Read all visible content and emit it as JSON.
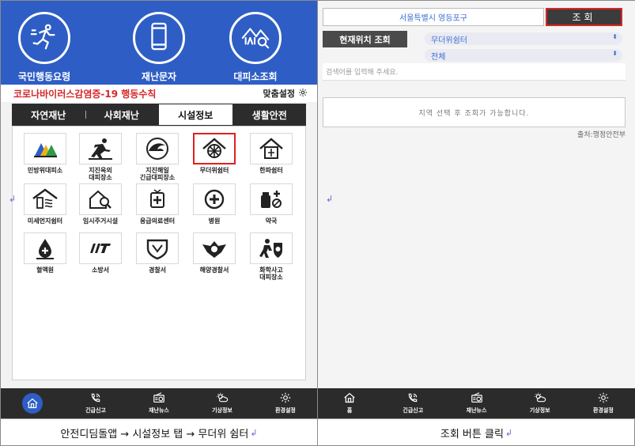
{
  "left": {
    "hero": {
      "items": [
        {
          "label": "국민행동요령",
          "icon": "running-person-icon"
        },
        {
          "label": "재난문자",
          "icon": "smartphone-icon"
        },
        {
          "label": "대피소조회",
          "icon": "shelter-search-icon"
        }
      ]
    },
    "covid_notice": "코로나바이러스감염증-19 행동수칙",
    "custom_settings": "맞춤설정",
    "tabs": [
      "자연재난",
      "사회재난",
      "시설정보",
      "생활안전"
    ],
    "active_tab": "시설정보",
    "facilities": [
      {
        "label": "민방위대피소",
        "icon": "civil-defense-shelter-icon"
      },
      {
        "label": "지진옥외\n대피장소",
        "icon": "earthquake-outdoor-icon"
      },
      {
        "label": "지진해일\n긴급대피장소",
        "icon": "tsunami-icon"
      },
      {
        "label": "무더위쉼터",
        "icon": "heat-shelter-icon",
        "selected": true
      },
      {
        "label": "한파쉼터",
        "icon": "cold-shelter-icon"
      },
      {
        "label": "미세먼지쉼터",
        "icon": "fine-dust-shelter-icon"
      },
      {
        "label": "임시주거시설",
        "icon": "temporary-housing-icon"
      },
      {
        "label": "응급의료센터",
        "icon": "emergency-medical-icon"
      },
      {
        "label": "병원",
        "icon": "hospital-icon"
      },
      {
        "label": "약국",
        "icon": "pharmacy-icon"
      },
      {
        "label": "혈액원",
        "icon": "blood-center-icon"
      },
      {
        "label": "소방서",
        "icon": "fire-station-icon"
      },
      {
        "label": "경찰서",
        "icon": "police-station-icon"
      },
      {
        "label": "해양경찰서",
        "icon": "coast-guard-icon"
      },
      {
        "label": "화학사고\n대피장소",
        "icon": "chemical-accident-icon"
      }
    ],
    "nav": [
      {
        "label": "",
        "icon": "home-icon"
      },
      {
        "label": "긴급신고",
        "icon": "emergency-call-icon"
      },
      {
        "label": "재난뉴스",
        "icon": "radio-news-icon"
      },
      {
        "label": "기상정보",
        "icon": "weather-icon"
      },
      {
        "label": "환경설정",
        "icon": "settings-gear-icon"
      }
    ],
    "caption": "안전디딤돌앱 → 시설정보 탭 → 무더위 쉼터"
  },
  "right": {
    "region": "서울특별시 영등포구",
    "search_button": "조회",
    "location_button": "현재위치 조회",
    "select_facility": "무더위쉼터",
    "select_area": "전체",
    "search_placeholder": "검색어를 입력해 주세요.",
    "empty_message": "지역 선택 후 조회가 가능합니다.",
    "source": "출처:행정안전부",
    "nav": [
      {
        "label": "홈",
        "icon": "home-icon"
      },
      {
        "label": "긴급신고",
        "icon": "emergency-call-icon"
      },
      {
        "label": "재난뉴스",
        "icon": "radio-news-icon"
      },
      {
        "label": "기상정보",
        "icon": "weather-icon"
      },
      {
        "label": "환경설정",
        "icon": "settings-gear-icon"
      }
    ],
    "caption": "조회 버튼 클릭"
  },
  "return_mark": "↲",
  "colors": {
    "header_blue": "#2e5ec5",
    "dark_bar": "#2b2b2b",
    "alert_red": "#d7272a",
    "link_blue": "#3c6fd0"
  }
}
